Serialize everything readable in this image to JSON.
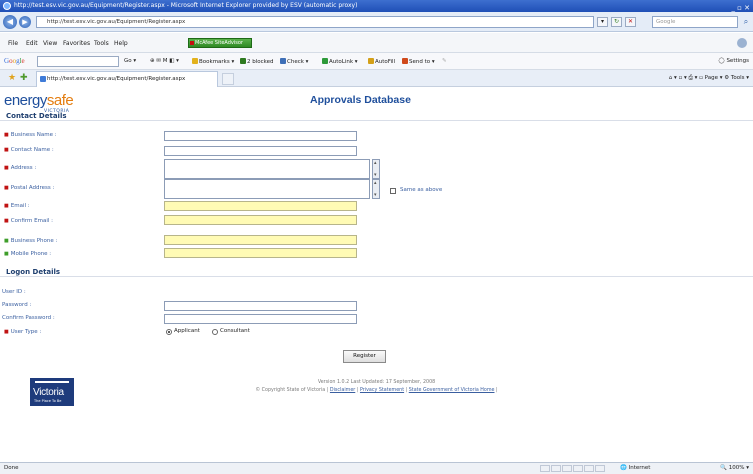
{
  "window": {
    "title": "http://test.esv.vic.gov.au/Equipment/Register.aspx - Microsoft Internet Explorer provided by ESV (automatic proxy)"
  },
  "address_bar": {
    "url": "http://test.esv.vic.gov.au/Equipment/Register.aspx",
    "search_placeholder": "Google"
  },
  "menu": {
    "items": [
      "File",
      "Edit",
      "View",
      "Favorites",
      "Tools",
      "Help"
    ],
    "mcafee_label": "McAfee SiteAdvisor"
  },
  "google_toolbar": {
    "logo": "Google",
    "go_label": "Go",
    "bookmarks": "Bookmarks",
    "blocked": "2 blocked",
    "check": "Check",
    "autolink": "AutoLink",
    "autofill": "AutoFill",
    "sendto": "Send to",
    "settings": "Settings"
  },
  "tab_bar": {
    "tab_title": "http://test.esv.vic.gov.au/Equipment/Register.aspx",
    "page_label": "Page",
    "tools_label": "Tools"
  },
  "page": {
    "logo_energy": "energy",
    "logo_safe": "safe",
    "logo_victoria": "VICTORIA",
    "title": "Approvals Database",
    "contact_heading": "Contact Details",
    "logon_heading": "Logon Details",
    "fields": {
      "business_name": "Business Name :",
      "contact_name": "Contact Name :",
      "address": "Address :",
      "postal_address": "Postal Address :",
      "same_as_above": "Same as above",
      "email": "Email :",
      "confirm_email": "Confirm Email :",
      "business_phone": "Business Phone :",
      "mobile_phone": "Mobile Phone :",
      "user_id": "User ID :",
      "password": "Password :",
      "confirm_password": "Confirm Password :",
      "user_type": "User Type :"
    },
    "user_type_options": [
      "Applicant",
      "Consultant"
    ],
    "user_type_selected": "Applicant",
    "register_label": "Register",
    "vic_logo_text": "Victoria",
    "vic_logo_tagline": "The Place To Be",
    "footer_version": "Version 1.0.2  Last Updated: 17 September, 2008",
    "footer_copyright": "© Copyright State of Victoria |",
    "footer_links": [
      "Disclaimer",
      "Privacy Statement",
      "State Government of Victoria Home"
    ]
  },
  "status_bar": {
    "left": "Done",
    "zone": "Internet",
    "zoom": "100%"
  },
  "colors": {
    "brand_blue": "#1f4f9c",
    "brand_orange": "#e47d10",
    "required_red": "#c01313",
    "highlight_field": "#fffbb5"
  }
}
